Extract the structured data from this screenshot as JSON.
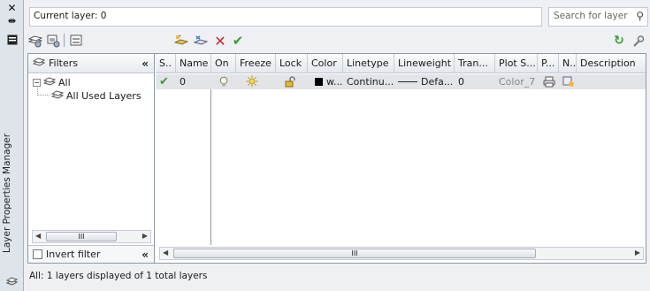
{
  "window": {
    "vertical_title": "Layer Properties Manager"
  },
  "topbar": {
    "current_layer": "Current layer: 0",
    "search_placeholder": "Search for layer"
  },
  "tree": {
    "header": "Filters",
    "nodes": [
      {
        "label": "All"
      },
      {
        "label": "All Used Layers"
      }
    ],
    "invert_filter": "Invert filter",
    "scroll_label": "III",
    "invert_checked": false
  },
  "list": {
    "columns": [
      "S..",
      "Name",
      "On",
      "Freeze",
      "Lock",
      "Color",
      "Linetype",
      "Lineweight",
      "Tran...",
      "Plot S...",
      "P...",
      "N..",
      "Description"
    ],
    "rows": [
      {
        "status": "✔",
        "name": "0",
        "color_label": "w...",
        "linetype": "Continu...",
        "lineweight": "Defa...",
        "transparency": "0",
        "plot_style": "Color_7"
      }
    ],
    "scroll_label": "III"
  },
  "status": "All: 1 layers displayed of 1 total layers",
  "colors": {
    "accent_green": "#3a9a2e",
    "delete_red": "#cc2a2a",
    "row_bg": "#e2e4e8"
  }
}
